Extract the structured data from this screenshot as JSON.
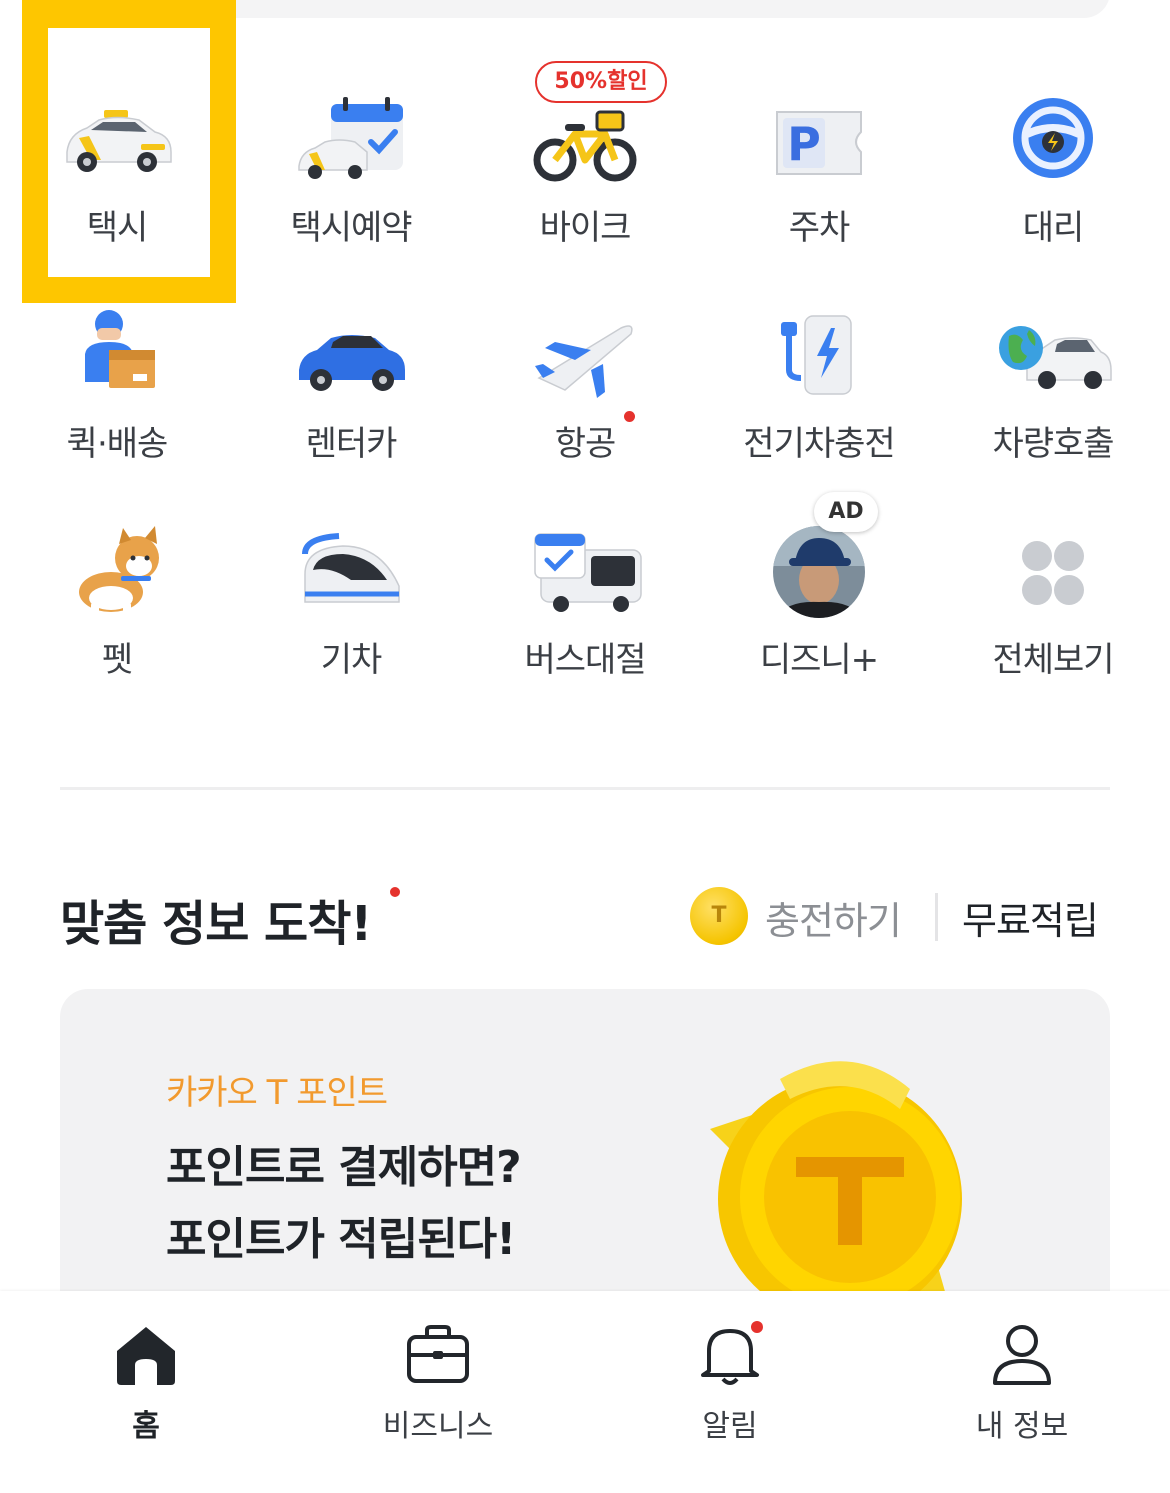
{
  "services": [
    {
      "label": "택시",
      "icon": "taxi-icon"
    },
    {
      "label": "택시예약",
      "icon": "taxi-reservation-icon"
    },
    {
      "label": "바이크",
      "icon": "bike-icon",
      "badge": "50%할인"
    },
    {
      "label": "주차",
      "icon": "parking-icon"
    },
    {
      "label": "대리",
      "icon": "steering-wheel-icon"
    },
    {
      "label": "퀵·배송",
      "icon": "delivery-icon"
    },
    {
      "label": "렌터카",
      "icon": "rental-car-icon"
    },
    {
      "label": "항공",
      "icon": "airplane-icon"
    },
    {
      "label": "전기차충전",
      "icon": "ev-charger-icon"
    },
    {
      "label": "차량호출",
      "icon": "vehicle-call-icon"
    },
    {
      "label": "펫",
      "icon": "pet-icon"
    },
    {
      "label": "기차",
      "icon": "train-icon"
    },
    {
      "label": "버스대절",
      "icon": "bus-charter-icon"
    },
    {
      "label": "디즈니+",
      "icon": "disney-plus-icon",
      "badge": "AD"
    },
    {
      "label": "전체보기",
      "icon": "view-all-icon"
    }
  ],
  "section": {
    "title": "맞춤 정보 도착!",
    "coin_glyph": "T",
    "charge_label": "충전하기",
    "free_label": "무료적립"
  },
  "card": {
    "eyebrow": "카카오 T 포인트",
    "line1": "포인트로 결제하면?",
    "line2": "포인트가 적립된다!"
  },
  "tabs": [
    {
      "label": "홈",
      "icon": "home-icon",
      "active": true
    },
    {
      "label": "비즈니스",
      "icon": "briefcase-icon"
    },
    {
      "label": "알림",
      "icon": "bell-icon"
    },
    {
      "label": "내 정보",
      "icon": "user-icon"
    }
  ],
  "colors": {
    "highlight": "#fec600",
    "badge_red": "#e5322d",
    "eyebrow_orange": "#f29a2e"
  }
}
